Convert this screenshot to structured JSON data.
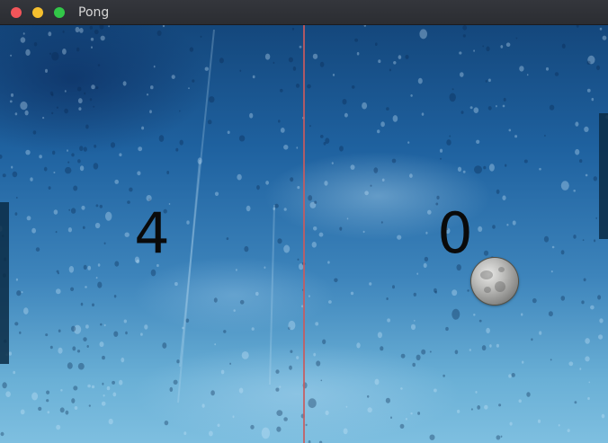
{
  "window": {
    "title": "Pong"
  },
  "scoreboard": {
    "left_score": "4",
    "right_score": "0"
  },
  "colors": {
    "net": "#c85a5e",
    "paddle": "#0b2c45",
    "score": "#0a0a0a"
  },
  "icons": {
    "ball": "moon-ball-icon"
  }
}
